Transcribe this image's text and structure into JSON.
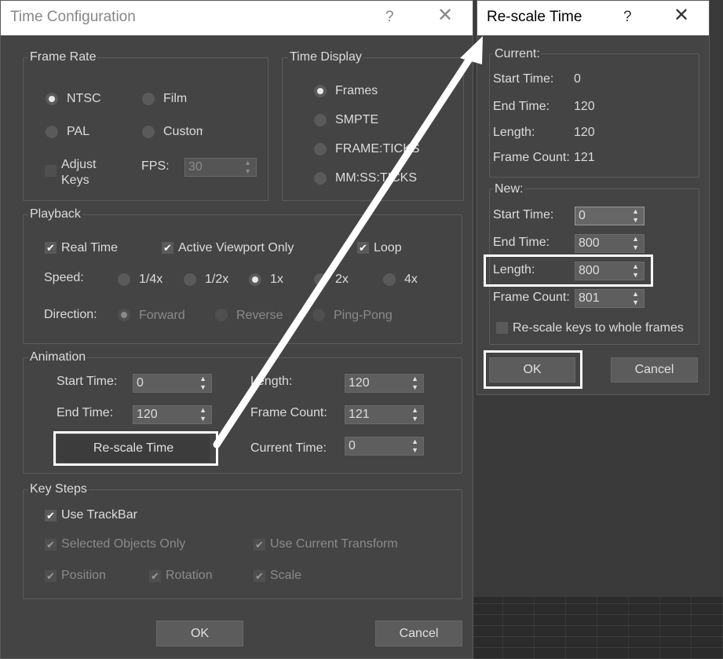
{
  "time_config": {
    "title": "Time Configuration",
    "help": "?",
    "close": "✕",
    "frame_rate": {
      "label": "Frame Rate",
      "ntsc": "NTSC",
      "film": "Film",
      "pal": "PAL",
      "custom": "Custom",
      "adjust_keys": "Adjust\nKeys",
      "fps_label": "FPS:",
      "fps_value": "30",
      "selected": "NTSC"
    },
    "time_display": {
      "label": "Time Display",
      "frames": "Frames",
      "smpte": "SMPTE",
      "frame_ticks": "FRAME:TICKS",
      "mm_ss_ticks": "MM:SS:TICKS",
      "selected": "Frames"
    },
    "playback": {
      "label": "Playback",
      "real_time": "Real Time",
      "active_viewport_only": "Active Viewport Only",
      "loop": "Loop",
      "speed_label": "Speed:",
      "speeds": [
        "1/4x",
        "1/2x",
        "1x",
        "2x",
        "4x"
      ],
      "speed_selected": "1x",
      "direction_label": "Direction:",
      "directions": [
        "Forward",
        "Reverse",
        "Ping-Pong"
      ]
    },
    "animation": {
      "label": "Animation",
      "start_time_label": "Start Time:",
      "start_time": "0",
      "end_time_label": "End Time:",
      "end_time": "120",
      "length_label": "Length:",
      "length": "120",
      "frame_count_label": "Frame Count:",
      "frame_count": "121",
      "current_time_label": "Current Time:",
      "current_time": "0",
      "rescale_button": "Re-scale Time"
    },
    "key_steps": {
      "label": "Key Steps",
      "use_trackbar": "Use TrackBar",
      "selected_objects_only": "Selected Objects Only",
      "use_current_transform": "Use Current Transform",
      "position": "Position",
      "rotation": "Rotation",
      "scale": "Scale"
    },
    "ok": "OK",
    "cancel": "Cancel"
  },
  "rescale": {
    "title": "Re-scale Time",
    "help": "?",
    "close": "✕",
    "current": {
      "label": "Current:",
      "start_time_label": "Start Time:",
      "start_time": "0",
      "end_time_label": "End Time:",
      "end_time": "120",
      "length_label": "Length:",
      "length": "120",
      "frame_count_label": "Frame Count:",
      "frame_count": "121"
    },
    "new": {
      "label": "New:",
      "start_time_label": "Start Time:",
      "start_time": "0",
      "end_time_label": "End Time:",
      "end_time": "800",
      "length_label": "Length:",
      "length": "800",
      "frame_count_label": "Frame Count:",
      "frame_count": "801",
      "rescale_keys": "Re-scale keys to whole frames"
    },
    "ok": "OK",
    "cancel": "Cancel"
  },
  "icons": {
    "spinner": "spinner-arrows-icon",
    "check": "✔"
  },
  "colors": {
    "dialog_bg": "#444444",
    "titlebar_bg": "#ffffff",
    "highlight": "#ffffff"
  }
}
